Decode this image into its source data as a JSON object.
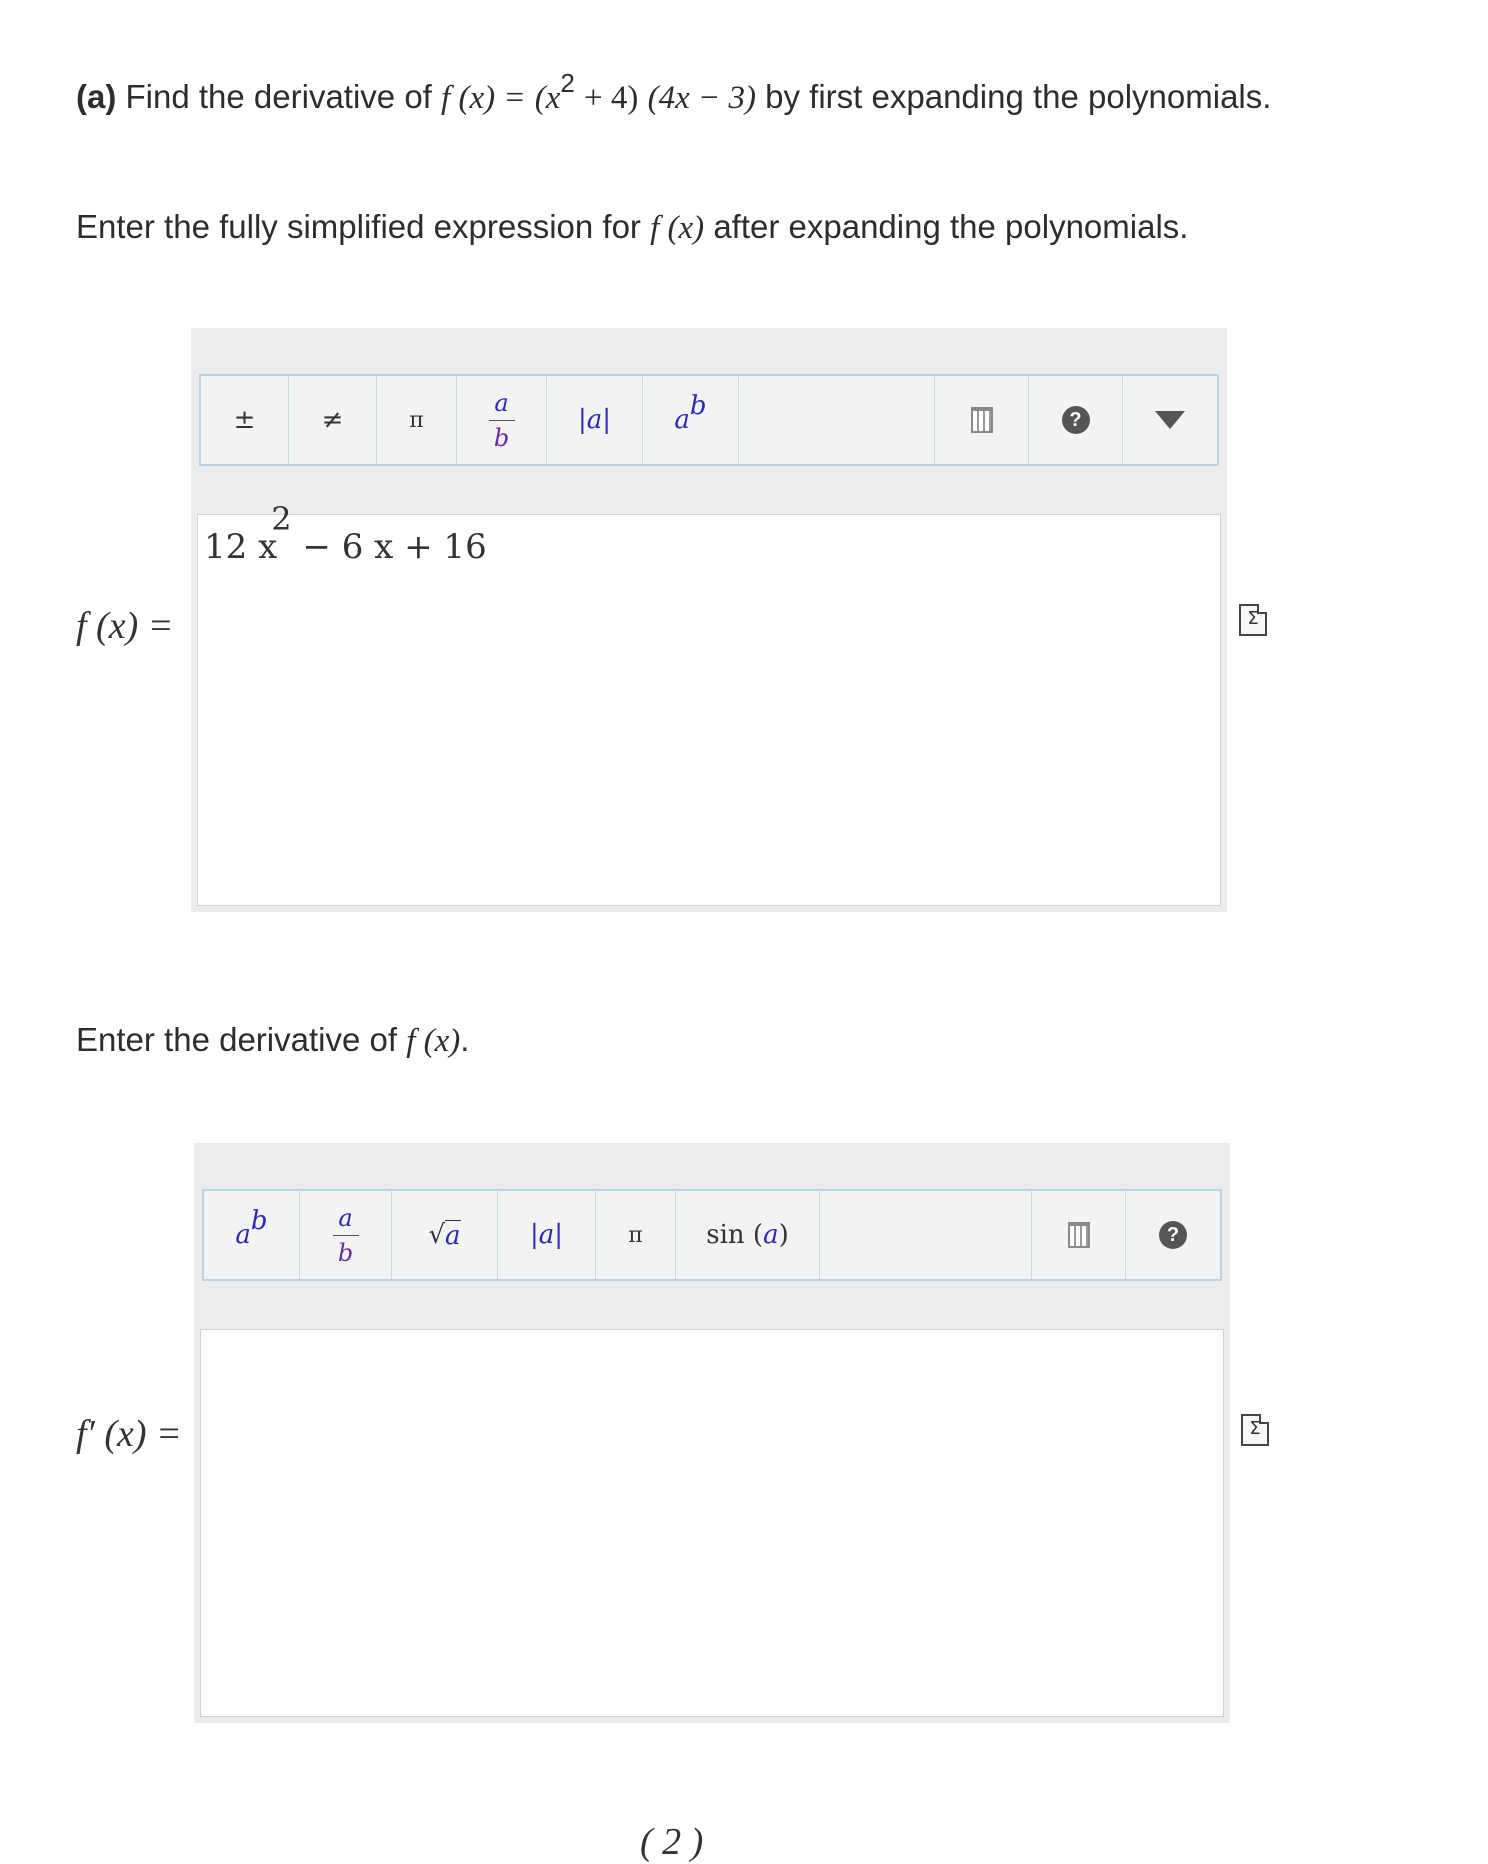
{
  "question": {
    "part_label": "(a)",
    "text_before": "Find the derivative of",
    "function_lhs": "f (x) =",
    "function_rhs_1": "(x",
    "function_rhs_exp": "2",
    "function_rhs_2": "+ 4)",
    "function_rhs_3": "(4x − 3)",
    "text_after": "by first expanding the polynomials."
  },
  "prompt1": {
    "before": "Enter the fully simplified expression for",
    "fx": "f (x)",
    "after": "after expanding the polynomials."
  },
  "editor1": {
    "toolbar": [
      "±",
      "≠",
      "π",
      "a/b",
      "|a|",
      "a^b"
    ],
    "toolbar_labels": {
      "plusminus": "±",
      "neq": "≠",
      "pi": "π",
      "frac_num": "a",
      "frac_den": "b",
      "abs": "|a|",
      "pow_base": "a",
      "pow_exp": "b"
    },
    "help_label": "?",
    "lhs": "f (x) =",
    "value_part1": "12 x",
    "value_exp": "2",
    "value_part2": " − 6 x + 16",
    "sigma_icon": "Σ"
  },
  "prompt2": {
    "before": "Enter the derivative of",
    "fx": "f (x)",
    "after": "."
  },
  "editor2": {
    "toolbar_labels": {
      "pow_base": "a",
      "pow_exp": "b",
      "frac_num": "a",
      "frac_den": "b",
      "sqrt": "√",
      "sqrt_arg": "a",
      "abs": "|a|",
      "pi": "π",
      "sin": "sin (",
      "sin_arg": "a",
      "sin_close": ")"
    },
    "help_label": "?",
    "lhs": "f′ (x) =",
    "value": "",
    "sigma_icon": "Σ"
  },
  "bottom_fragment": "( 2 )"
}
